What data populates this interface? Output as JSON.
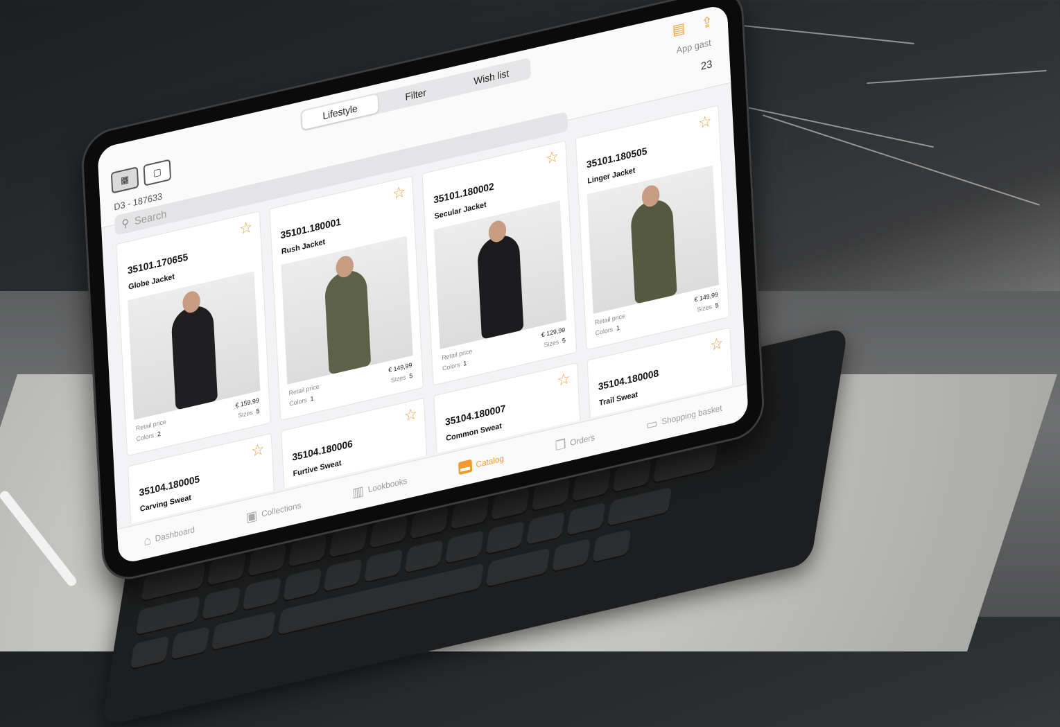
{
  "app": {
    "segments": [
      "Lifestyle",
      "Filter",
      "Wish list"
    ],
    "selected_segment": "Lifestyle",
    "user_label": "App gast",
    "item_count": "23",
    "order_ref": "D3 - 187633",
    "search_placeholder": "Search",
    "accent_color": "#f29a2b"
  },
  "products": [
    {
      "code": "35101.170655",
      "name": "Globe Jacket",
      "price_label": "Retail price",
      "price": "€ 159,99",
      "colors_label": "Colors",
      "colors": "2",
      "sizes_label": "Sizes",
      "sizes": "5",
      "garment_color": "#1f1f21"
    },
    {
      "code": "35101.180001",
      "name": "Rush Jacket",
      "price_label": "Retail price",
      "price": "€ 149,99",
      "colors_label": "Colors",
      "colors": "1",
      "sizes_label": "Sizes",
      "sizes": "5",
      "garment_color": "#5c6148"
    },
    {
      "code": "35101.180002",
      "name": "Secular Jacket",
      "price_label": "Retail price",
      "price": "€ 129,99",
      "colors_label": "Colors",
      "colors": "1",
      "sizes_label": "Sizes",
      "sizes": "5",
      "garment_color": "#1b1b1d"
    },
    {
      "code": "35101.180505",
      "name": "Linger Jacket",
      "price_label": "Retail price",
      "price": "€ 149,99",
      "colors_label": "Colors",
      "colors": "1",
      "sizes_label": "Sizes",
      "sizes": "5",
      "garment_color": "#55593f"
    },
    {
      "code": "35104.180005",
      "name": "Carving Sweat",
      "garment_color": "#4b5367"
    },
    {
      "code": "35104.180006",
      "name": "Furtive Sweat",
      "garment_color": "#8e8f90"
    },
    {
      "code": "35104.180007",
      "name": "Common Sweat",
      "garment_color": "#e0704f"
    },
    {
      "code": "35104.180008",
      "name": "Trail Sweat",
      "garment_color": "#9aa7a2"
    }
  ],
  "tabs": [
    {
      "label": "Dashboard",
      "icon": "home-icon"
    },
    {
      "label": "Collections",
      "icon": "box-icon"
    },
    {
      "label": "Lookbooks",
      "icon": "film-icon"
    },
    {
      "label": "Catalog",
      "icon": "catalog-icon",
      "active": true
    },
    {
      "label": "Orders",
      "icon": "clipboard-icon"
    },
    {
      "label": "Shopping basket",
      "icon": "basket-icon"
    }
  ]
}
